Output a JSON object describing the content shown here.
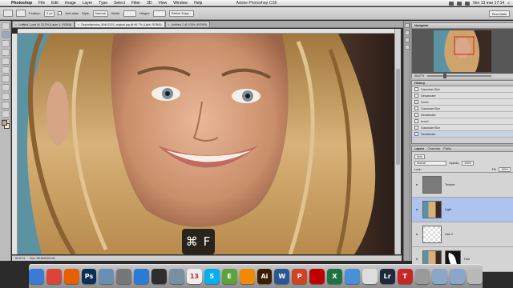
{
  "menubar": {
    "apple": "",
    "items": [
      "Photoshop",
      "File",
      "Edit",
      "Image",
      "Layer",
      "Type",
      "Select",
      "Filter",
      "3D",
      "View",
      "Window",
      "Help"
    ],
    "window_title": "Adobe Photoshop CS6",
    "clock": "Ven 13 mar 17:14"
  },
  "options": {
    "feather_label": "Feather:",
    "feather_value": "0 px",
    "antialias_label": "Anti-alias",
    "style_label": "Style:",
    "style_value": "Normal",
    "width_label": "Width:",
    "height_label": "Height:",
    "refine_button": "Refine Edge...",
    "workspace": "Essentials"
  },
  "tabs": [
    "Untitled-1.psd @ 33.3% (Layer 1, RGB/8)",
    "Depositphotos_59441519_original.jpg @ 66.7% (Light, RGB/8)",
    "Untitled-2 @ 100% (RGB/8)"
  ],
  "status": {
    "zoom": "66.67%",
    "doc": "Doc: 58.6M/245.0M"
  },
  "hotkey": {
    "text": "⌘ F"
  },
  "navigator": {
    "title": "Navigator",
    "zoom": "66.67%"
  },
  "history": {
    "title": "History",
    "items": [
      "Gaussian Blur",
      "Desaturate",
      "Invert",
      "Gaussian Blur",
      "Desaturate",
      "Invert",
      "Gaussian Blur",
      "Desaturate"
    ],
    "selected_index": 7
  },
  "layers": {
    "tabs": [
      "Layers",
      "Channels",
      "Paths"
    ],
    "kind_label": "Kind",
    "blend_mode": "Normal",
    "opacity_label": "Opacity:",
    "opacity_value": "100%",
    "lock_label": "Lock:",
    "fill_label": "Fill:",
    "fill_value": "100%",
    "items": [
      {
        "name": "Texture",
        "thumb": "gray"
      },
      {
        "name": "Light",
        "thumb": "photo"
      },
      {
        "name": "Hair 2",
        "thumb": "transparent"
      },
      {
        "name": "Hair",
        "thumb": "photo-mask"
      }
    ],
    "selected_index": 1
  },
  "dock": {
    "icons": [
      {
        "name": "finder",
        "color": "#3a7bd5",
        "glyph": ""
      },
      {
        "name": "chrome",
        "color": "#db4437",
        "glyph": ""
      },
      {
        "name": "firefox",
        "color": "#e66000",
        "glyph": ""
      },
      {
        "name": "photoshop",
        "color": "#0b2f57",
        "glyph": "Ps"
      },
      {
        "name": "photos",
        "color": "#6a8fb3",
        "glyph": ""
      },
      {
        "name": "system-preferences",
        "color": "#777777",
        "glyph": ""
      },
      {
        "name": "safari",
        "color": "#2a7ad8",
        "glyph": ""
      },
      {
        "name": "activity-monitor",
        "color": "#2e2e2e",
        "glyph": ""
      },
      {
        "name": "preview",
        "color": "#7a8fa4",
        "glyph": ""
      },
      {
        "name": "calendar",
        "color": "#eeeeee",
        "glyph": "13"
      },
      {
        "name": "skype",
        "color": "#00aff0",
        "glyph": "S"
      },
      {
        "name": "evernote",
        "color": "#5aa43a",
        "glyph": "E"
      },
      {
        "name": "vlc",
        "color": "#f08a00",
        "glyph": ""
      },
      {
        "name": "illustrator",
        "color": "#3b1d00",
        "glyph": "Ai"
      },
      {
        "name": "word",
        "color": "#2b5797",
        "glyph": "W"
      },
      {
        "name": "powerpoint",
        "color": "#d04423",
        "glyph": "P"
      },
      {
        "name": "filezilla",
        "color": "#bf0000",
        "glyph": ""
      },
      {
        "name": "excel",
        "color": "#1f7244",
        "glyph": "X"
      },
      {
        "name": "itunes",
        "color": "#4b8fd9",
        "glyph": ""
      },
      {
        "name": "textedit",
        "color": "#dddddd",
        "glyph": ""
      },
      {
        "name": "lightroom",
        "color": "#1c2a3a",
        "glyph": "Lr"
      },
      {
        "name": "text-tool-app",
        "color": "#c62828",
        "glyph": "T"
      },
      {
        "name": "bluetooth",
        "color": "#9a9a9a",
        "glyph": ""
      },
      {
        "name": "downloads",
        "color": "#8aa7c8",
        "glyph": ""
      },
      {
        "name": "documents",
        "color": "#8aa7c8",
        "glyph": ""
      },
      {
        "name": "trash",
        "color": "#b9b9b9",
        "glyph": ""
      }
    ]
  }
}
